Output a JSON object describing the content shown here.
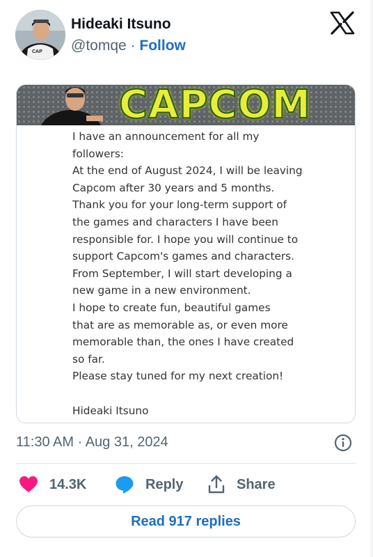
{
  "author": {
    "name": "Hideaki Itsuno",
    "handle": "@tomqe",
    "separator": "·",
    "follow_label": "Follow"
  },
  "media": {
    "banner_text": "CAPCOM",
    "letter": "I have an announcement for all my\nfollowers:\nAt the end of August 2024, I will be leaving\nCapcom after 30 years and 5 months.\nThank you for your long-term support of\nthe games and characters I have been\nresponsible for. I hope you will continue to\nsupport Capcom's games and characters.\nFrom September, I will start developing a\nnew game in a new environment.\nI hope to create fun, beautiful games\nthat are as memorable as, or even more\nmemorable than, the ones I have created\nso far.\nPlease stay tuned for my next creation!\n\nHideaki Itsuno"
  },
  "meta": {
    "timestamp": "11:30 AM · Aug 31, 2024"
  },
  "actions": {
    "like_count": "14.3K",
    "reply_label": "Reply",
    "share_label": "Share",
    "read_replies_label": "Read 917 replies"
  },
  "colors": {
    "link": "#1d6fbf",
    "heart": "#f91880",
    "reply_bubble": "#1d9bf0",
    "muted": "#536471"
  },
  "icons": [
    "x-logo-icon",
    "info-icon",
    "heart-icon",
    "reply-icon",
    "share-icon"
  ]
}
